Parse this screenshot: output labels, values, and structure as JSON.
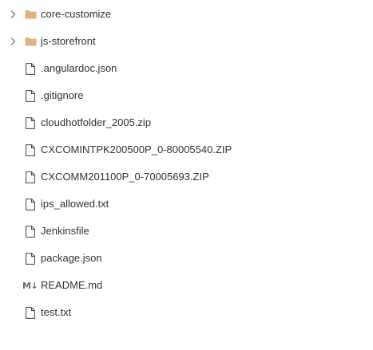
{
  "explorer": {
    "items": [
      {
        "label": "core-customize",
        "type": "folder",
        "icon": "folder-icon",
        "expandable": true
      },
      {
        "label": "js-storefront",
        "type": "folder",
        "icon": "folder-icon",
        "expandable": true
      },
      {
        "label": ".angulardoc.json",
        "type": "file",
        "icon": "file-icon"
      },
      {
        "label": ".gitignore",
        "type": "file",
        "icon": "file-icon"
      },
      {
        "label": "cloudhotfolder_2005.zip",
        "type": "file",
        "icon": "file-icon"
      },
      {
        "label": "CXCOMINTPK200500P_0-80005540.ZIP",
        "type": "file",
        "icon": "file-icon"
      },
      {
        "label": "CXCOMM201100P_0-70005693.ZIP",
        "type": "file",
        "icon": "file-icon"
      },
      {
        "label": "ips_allowed.txt",
        "type": "file",
        "icon": "file-icon"
      },
      {
        "label": "Jenkinsfile",
        "type": "file",
        "icon": "file-icon"
      },
      {
        "label": "package.json",
        "type": "file",
        "icon": "file-icon"
      },
      {
        "label": "README.md",
        "type": "file",
        "icon": "markdown-icon",
        "icon_text": "M↓"
      },
      {
        "label": "test.txt",
        "type": "file",
        "icon": "file-icon"
      }
    ]
  },
  "colors": {
    "folder": "#dcb67a",
    "chevron": "#6e6e6e",
    "file_outline": "#424242",
    "text": "#333333",
    "background": "#ffffff"
  }
}
